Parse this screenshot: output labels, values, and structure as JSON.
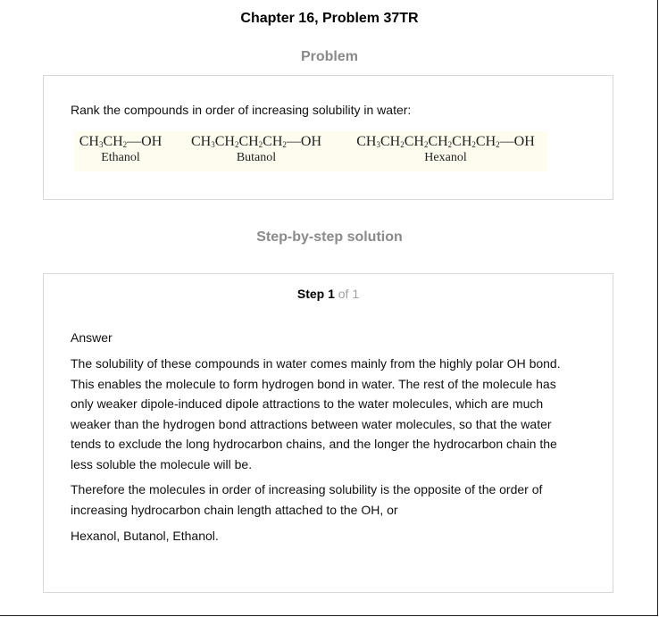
{
  "page": {
    "title": "Chapter 16, Problem 37TR"
  },
  "problem_section": {
    "heading": "Problem",
    "question": "Rank the compounds in order of increasing solubility in water:",
    "compounds": [
      {
        "formula_html": "CH<sub>3</sub>CH<sub>2</sub>—OH",
        "name": "Ethanol"
      },
      {
        "formula_html": "CH<sub>3</sub>CH<sub>2</sub>CH<sub>2</sub>CH<sub>2</sub>—OH",
        "name": "Butanol"
      },
      {
        "formula_html": "CH<sub>3</sub>CH<sub>2</sub>CH<sub>2</sub>CH<sub>2</sub>CH<sub>2</sub>CH<sub>2</sub>—OH",
        "name": "Hexanol"
      }
    ]
  },
  "solution_section": {
    "heading": "Step-by-step solution",
    "step_label": "Step 1",
    "step_of": "of 1",
    "answer_label": "Answer",
    "paragraphs": [
      "The solubility of these compounds in water comes mainly from the highly polar OH bond. This enables the molecule to form hydrogen bond in water. The rest of the molecule has only weaker dipole-induced dipole attractions to the water molecules, which are much weaker than the hydrogen bond attractions between water molecules, so that the water tends to exclude the long hydrocarbon chains, and the longer the hydrocarbon chain the less soluble the molecule will be.",
      "Therefore the molecules in order of increasing solubility is the opposite of the order of increasing hydrocarbon chain length attached to the OH, or",
      "Hexanol, Butanol, Ethanol."
    ]
  }
}
